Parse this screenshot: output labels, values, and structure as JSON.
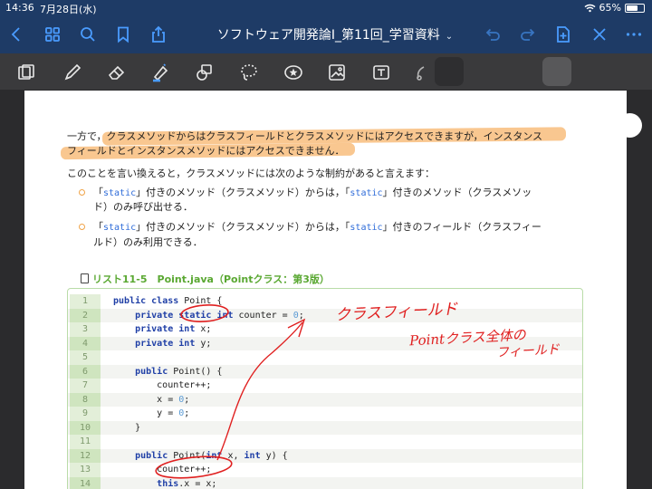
{
  "status": {
    "time": "14:36",
    "date": "7月28日(水)",
    "battery": "65%",
    "battery_level": 0.65
  },
  "nav": {
    "title": "ソフトウェア開発論I_第11回_学習資料"
  },
  "icons": {
    "back": "chevron-left-icon",
    "grid": "grid-icon",
    "search": "search-icon",
    "bookmark": "bookmark-icon",
    "share": "share-icon",
    "undo": "undo-icon",
    "redo": "redo-icon",
    "add_page": "add-page-icon",
    "close": "close-icon",
    "more": "more-icon"
  },
  "colors": {
    "navbar": "#1e3b66",
    "accent": "#4a9cff",
    "toolbar": "#3a3a3c",
    "swatches": [
      "#c68a3c",
      "#d79a9e",
      "#8fb7c6",
      "#ffffff",
      "#ffffff",
      "#ffffff"
    ],
    "highlight": "#f7b46b",
    "ink": "#e02020",
    "listing_green": "#5aa832"
  },
  "document": {
    "para1_line1": "一方で，クラスメソッドからはクラスフィールドとクラスメソッドにはアクセスできますが，インスタンス",
    "para1_line2": "フィールドとインスタンスメソッドにはアクセスできません．",
    "para2": "このことを言い換えると，クラスメソッドには次のような制約があると言えます：",
    "bullet1_a": "「",
    "bullet1_kw1": "static",
    "bullet1_b": "」付きのメソッド（クラスメソッド）からは，「",
    "bullet1_kw2": "static",
    "bullet1_c": "」付きのメソッド（クラスメソッ",
    "bullet1_line2": "ド）のみ呼び出せる．",
    "bullet2_a": "「",
    "bullet2_kw1": "static",
    "bullet2_b": "」付きのメソッド（クラスメソッド）からは，「",
    "bullet2_kw2": "static",
    "bullet2_c": "」付きのフィールド（クラスフィー",
    "bullet2_line2": "ルド）のみ利用できる．",
    "listing_title": "リスト11-5　Point.java（Pointクラス：第3版）"
  },
  "code": {
    "lines": [
      {
        "n": "1",
        "t": "public class Point {"
      },
      {
        "n": "2",
        "t": "    private static int counter = 0;"
      },
      {
        "n": "3",
        "t": "    private int x;"
      },
      {
        "n": "4",
        "t": "    private int y;"
      },
      {
        "n": "5",
        "t": ""
      },
      {
        "n": "6",
        "t": "    public Point() {"
      },
      {
        "n": "7",
        "t": "        counter++;"
      },
      {
        "n": "8",
        "t": "        x = 0;"
      },
      {
        "n": "9",
        "t": "        y = 0;"
      },
      {
        "n": "10",
        "t": "    }"
      },
      {
        "n": "11",
        "t": ""
      },
      {
        "n": "12",
        "t": "    public Point(int x, int y) {"
      },
      {
        "n": "13",
        "t": "        counter++;"
      },
      {
        "n": "14",
        "t": "        this.x = x;"
      }
    ]
  },
  "annotations": {
    "note1": "クラスフィールド",
    "note2": "Pointクラス全体の",
    "note3": "フィールド"
  }
}
